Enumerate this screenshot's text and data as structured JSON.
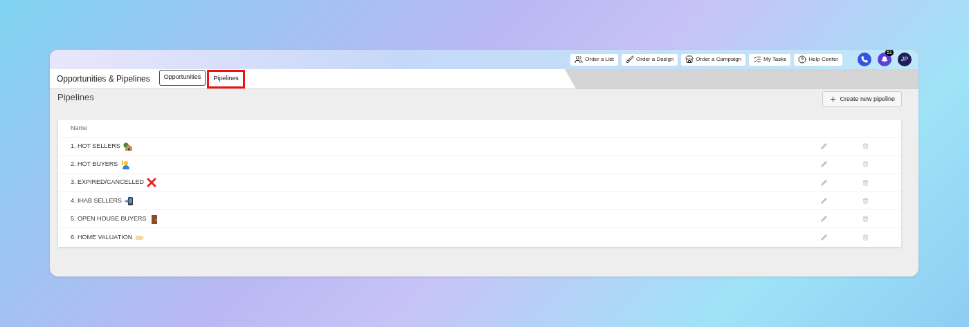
{
  "toolbar": {
    "buttons": [
      {
        "label": "Order a List",
        "kind": "people"
      },
      {
        "label": "Order a Design",
        "kind": "brush"
      },
      {
        "label": "Order a Campaign",
        "kind": "store"
      },
      {
        "label": "My Tasks",
        "kind": "list"
      },
      {
        "label": "Help Center",
        "kind": "help"
      }
    ],
    "notification_count": "51",
    "avatar": "JP"
  },
  "header": {
    "title": "Opportunities & Pipelines",
    "tabs": [
      {
        "label": "Opportunities",
        "selected": false
      },
      {
        "label": "Pipelines",
        "selected": true
      }
    ]
  },
  "page": {
    "title": "Pipelines",
    "create_button": "Create new pipeline"
  },
  "table": {
    "columns": [
      "Name"
    ],
    "rows": [
      {
        "name": "1. HOT SELLERS",
        "kind": "house"
      },
      {
        "name": "2. HOT BUYERS",
        "kind": "person"
      },
      {
        "name": "3. EXPIRED/CANCELLED",
        "kind": "cross"
      },
      {
        "name": "4. IHAB SELLERS",
        "kind": "phone"
      },
      {
        "name": "5. OPEN HOUSE BUYERS",
        "kind": "door"
      },
      {
        "name": "6. HOME VALUATION",
        "kind": "tag"
      }
    ]
  }
}
